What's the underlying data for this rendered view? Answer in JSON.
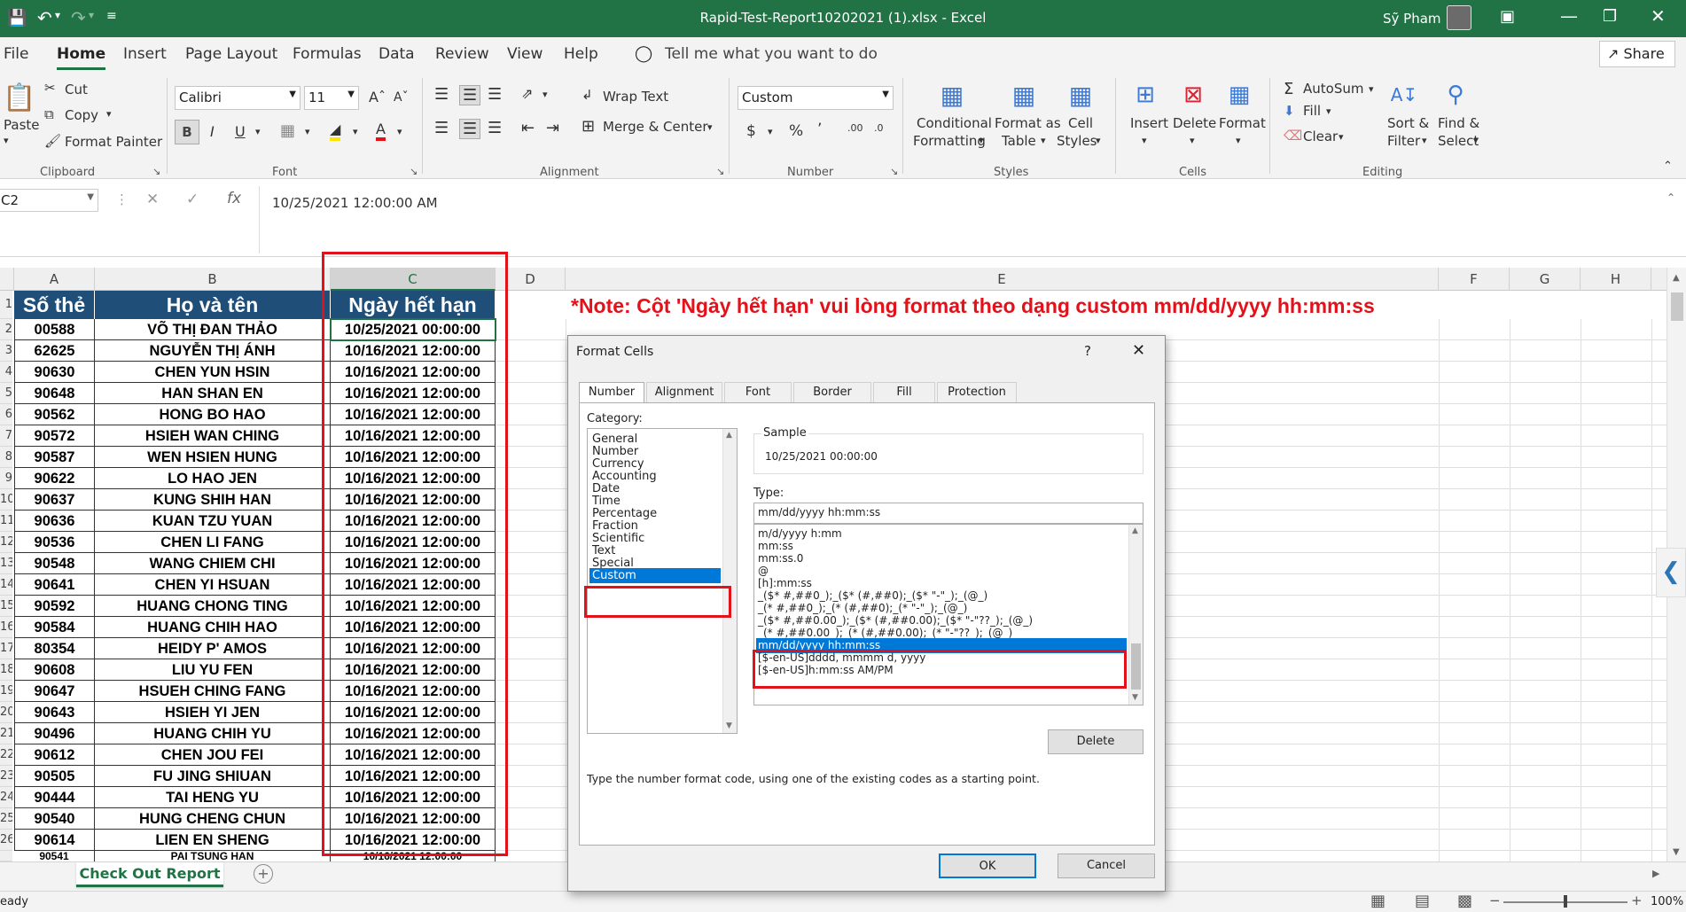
{
  "titlebar": {
    "title": "Rapid-Test-Report10202021 (1).xlsx  -  Excel",
    "user": "Sỹ Pham"
  },
  "menu_tabs": [
    "File",
    "Home",
    "Insert",
    "Page Layout",
    "Formulas",
    "Data",
    "Review",
    "View",
    "Help"
  ],
  "tell_me": "Tell me what you want to do",
  "share_label": "Share",
  "clipboard": {
    "paste": "Paste",
    "cut": "Cut",
    "copy": "Copy",
    "format_painter": "Format Painter",
    "group": "Clipboard"
  },
  "font": {
    "name": "Calibri",
    "size": "11",
    "group": "Font"
  },
  "alignment": {
    "wrap": "Wrap Text",
    "merge": "Merge & Center",
    "group": "Alignment"
  },
  "number": {
    "format": "Custom",
    "group": "Number"
  },
  "styles": {
    "cond1": "Conditional",
    "cond2": "Formatting",
    "fmt1": "Format as",
    "fmt2": "Table",
    "cell1": "Cell",
    "cell2": "Styles",
    "group": "Styles"
  },
  "cells": {
    "insert": "Insert",
    "delete": "Delete",
    "format": "Format",
    "group": "Cells"
  },
  "editing": {
    "autosum": "AutoSum",
    "fill": "Fill",
    "clear": "Clear",
    "sort1": "Sort &",
    "sort2": "Filter",
    "find1": "Find &",
    "find2": "Select",
    "group": "Editing"
  },
  "formula_bar": {
    "name_box": "C2",
    "value": "10/25/2021  12:00:00 AM"
  },
  "columns": [
    "A",
    "B",
    "C",
    "D",
    "E",
    "F",
    "G",
    "H"
  ],
  "headers": {
    "a": "Số thẻ",
    "b": "Họ và tên",
    "c": "Ngày hết hạn"
  },
  "note": "*Note: Cột 'Ngày hết hạn' vui lòng format theo dạng custom mm/dd/yyyy hh:mm:ss",
  "rows": [
    {
      "r": "2",
      "id": "00588",
      "name": "VÕ THỊ ĐAN THẢO",
      "date": "10/25/2021 00:00:00"
    },
    {
      "r": "3",
      "id": "62625",
      "name": "NGUYỄN THỊ ÁNH",
      "date": "10/16/2021 12:00:00"
    },
    {
      "r": "4",
      "id": "90630",
      "name": "CHEN YUN HSIN",
      "date": "10/16/2021 12:00:00"
    },
    {
      "r": "5",
      "id": "90648",
      "name": "HAN SHAN EN",
      "date": "10/16/2021 12:00:00"
    },
    {
      "r": "6",
      "id": "90562",
      "name": "HONG BO HAO",
      "date": "10/16/2021 12:00:00"
    },
    {
      "r": "7",
      "id": "90572",
      "name": "HSIEH WAN CHING",
      "date": "10/16/2021 12:00:00"
    },
    {
      "r": "8",
      "id": "90587",
      "name": "WEN HSIEN HUNG",
      "date": "10/16/2021 12:00:00"
    },
    {
      "r": "9",
      "id": "90622",
      "name": "LO HAO JEN",
      "date": "10/16/2021 12:00:00"
    },
    {
      "r": "10",
      "id": "90637",
      "name": "KUNG SHIH HAN",
      "date": "10/16/2021 12:00:00"
    },
    {
      "r": "11",
      "id": "90636",
      "name": "KUAN TZU YUAN",
      "date": "10/16/2021 12:00:00"
    },
    {
      "r": "12",
      "id": "90536",
      "name": "CHEN LI FANG",
      "date": "10/16/2021 12:00:00"
    },
    {
      "r": "13",
      "id": "90548",
      "name": "WANG CHIEM CHI",
      "date": "10/16/2021 12:00:00"
    },
    {
      "r": "14",
      "id": "90641",
      "name": "CHEN YI HSUAN",
      "date": "10/16/2021 12:00:00"
    },
    {
      "r": "15",
      "id": "90592",
      "name": "HUANG CHONG TING",
      "date": "10/16/2021 12:00:00"
    },
    {
      "r": "16",
      "id": "90584",
      "name": "HUANG CHIH HAO",
      "date": "10/16/2021 12:00:00"
    },
    {
      "r": "17",
      "id": "80354",
      "name": "HEIDY P' AMOS",
      "date": "10/16/2021 12:00:00"
    },
    {
      "r": "18",
      "id": "90608",
      "name": "LIU YU FEN",
      "date": "10/16/2021 12:00:00"
    },
    {
      "r": "19",
      "id": "90647",
      "name": "HSUEH CHING FANG",
      "date": "10/16/2021 12:00:00"
    },
    {
      "r": "20",
      "id": "90643",
      "name": "HSIEH YI JEN",
      "date": "10/16/2021 12:00:00"
    },
    {
      "r": "21",
      "id": "90496",
      "name": "HUANG CHIH YU",
      "date": "10/16/2021 12:00:00"
    },
    {
      "r": "22",
      "id": "90612",
      "name": "CHEN JOU FEI",
      "date": "10/16/2021 12:00:00"
    },
    {
      "r": "23",
      "id": "90505",
      "name": "FU JING SHIUAN",
      "date": "10/16/2021 12:00:00"
    },
    {
      "r": "24",
      "id": "90444",
      "name": "TAI HENG YU",
      "date": "10/16/2021 12:00:00"
    },
    {
      "r": "25",
      "id": "90540",
      "name": "HUNG CHENG CHUN",
      "date": "10/16/2021 12:00:00"
    },
    {
      "r": "26",
      "id": "90614",
      "name": "LIEN EN SHENG",
      "date": "10/16/2021 12:00:00"
    }
  ],
  "partial_row": {
    "id": "90541",
    "name": "PAI TSUNG HAN",
    "date": "10/16/2021 12:00:00"
  },
  "sheet_tab": "Check Out Report",
  "status": {
    "ready": "eady",
    "zoom": "100%"
  },
  "dialog": {
    "title": "Format Cells",
    "help": "?",
    "tabs": [
      "Number",
      "Alignment",
      "Font",
      "Border",
      "Fill",
      "Protection"
    ],
    "category_label": "Category:",
    "categories": [
      "General",
      "Number",
      "Currency",
      "Accounting",
      "Date",
      "Time",
      "Percentage",
      "Fraction",
      "Scientific",
      "Text",
      "Special",
      "Custom"
    ],
    "sample_label": "Sample",
    "sample_value": "10/25/2021 00:00:00",
    "type_label": "Type:",
    "type_value": "mm/dd/yyyy hh:mm:ss",
    "type_list": [
      "m/d/yyyy h:mm",
      "mm:ss",
      "mm:ss.0",
      "@",
      "[h]:mm:ss",
      "_($* #,##0_);_($* (#,##0);_($* \"-\"_);_(@_)",
      "_(* #,##0_);_(* (#,##0);_(* \"-\"_);_(@_)",
      "_($* #,##0.00_);_($* (#,##0.00);_($* \"-\"??_);_(@_)",
      "_(* #,##0.00_);_(* (#,##0.00);_(* \"-\"??_);_(@_)",
      "mm/dd/yyyy hh:mm:ss",
      "[$-en-US]dddd, mmmm d, yyyy",
      "[$-en-US]h:mm:ss AM/PM"
    ],
    "delete": "Delete",
    "hint": "Type the number format code, using one of the existing codes as a starting point.",
    "ok": "OK",
    "cancel": "Cancel"
  },
  "colors": {
    "excel_green": "#217346",
    "header_blue": "#1f4e78",
    "note_red": "#e3121a",
    "selection_blue": "#0078d7"
  }
}
